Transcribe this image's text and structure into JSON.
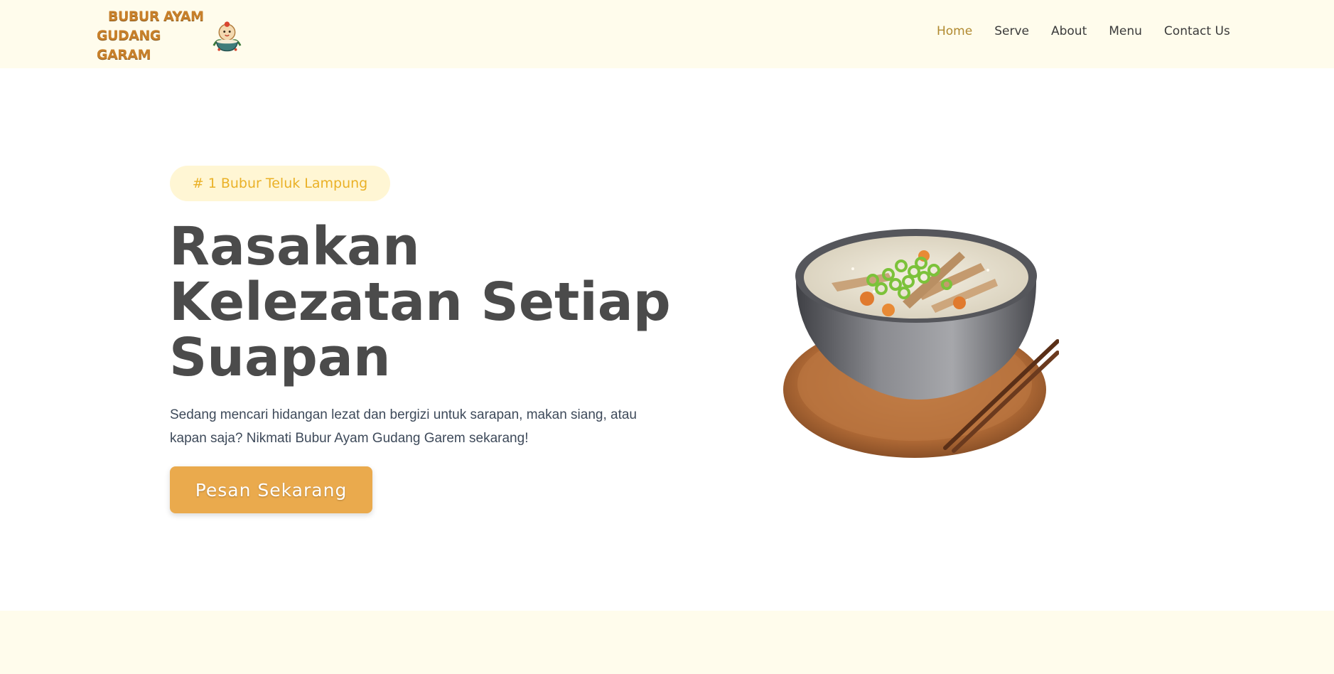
{
  "brand": {
    "line1": "BUBUR AYAM",
    "line2": "GUDANG GARAM",
    "icon": "bowl-mascot-icon",
    "color": "#c8802a"
  },
  "nav": {
    "items": [
      {
        "label": "Home",
        "active": true
      },
      {
        "label": "Serve",
        "active": false
      },
      {
        "label": "About",
        "active": false
      },
      {
        "label": "Menu",
        "active": false
      },
      {
        "label": "Contact Us",
        "active": false
      }
    ],
    "active_color": "#b0892f"
  },
  "hero": {
    "badge": "# 1 Bubur Teluk Lampung",
    "headline": [
      "Rasakan",
      "Kelezatan Setiap",
      "Suapan"
    ],
    "description_line1": "Sedang mencari hidangan lezat dan bergizi untuk sarapan, makan siang, atau",
    "description_line2": "kapan saja? Nikmati Bubur Ayam Gudang Garem sekarang!",
    "cta": "Pesan Sekarang",
    "image": "bubur-ayam-bowl-image"
  },
  "colors": {
    "header_bg": "#fffcec",
    "accent": "#eaaa4d",
    "badge_bg": "#fff6d4",
    "badge_text": "#eab127",
    "heading": "#4b4b4b"
  }
}
